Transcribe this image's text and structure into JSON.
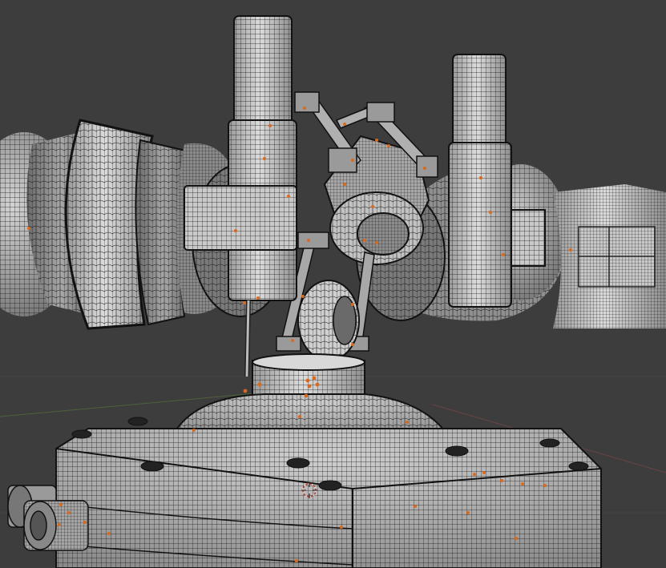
{
  "viewport": {
    "mode": "wireframe-on-shaded",
    "background_color": "#3d3d3d",
    "mesh_color": "#d8d8d8",
    "wire_color": "#1a1a1a",
    "vertex_highlight_color": "#d86a1e",
    "grid_x_axis_color": "#8a4a4a",
    "grid_y_axis_color": "#5a7a3a"
  },
  "objects": [
    {
      "name": "left-rotor-pod",
      "icon": "mesh-icon"
    },
    {
      "name": "right-rotor-pod",
      "icon": "mesh-icon"
    },
    {
      "name": "left-vertical-shaft",
      "icon": "mesh-icon"
    },
    {
      "name": "right-vertical-shaft",
      "icon": "mesh-icon"
    },
    {
      "name": "central-hub",
      "icon": "mesh-icon"
    },
    {
      "name": "linkage-struts",
      "icon": "mesh-icon"
    },
    {
      "name": "pivot-wheel",
      "icon": "mesh-icon"
    },
    {
      "name": "neck-collar",
      "icon": "mesh-icon"
    },
    {
      "name": "base-housing",
      "icon": "mesh-icon"
    }
  ],
  "cursor": {
    "icon": "3d-cursor-icon"
  }
}
